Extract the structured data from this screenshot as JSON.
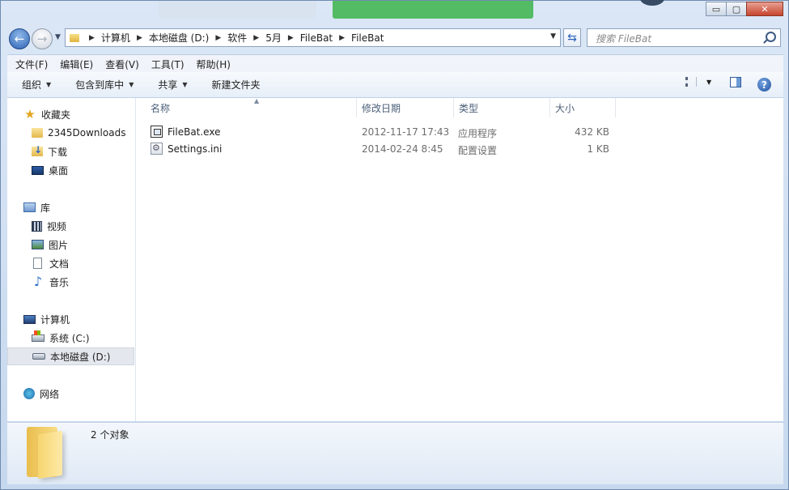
{
  "window": {
    "controls": {
      "minimize": "▭",
      "maximize": "▢",
      "close": "✕"
    }
  },
  "nav": {
    "breadcrumbs": [
      "计算机",
      "本地磁盘 (D:)",
      "软件",
      "5月",
      "FileBat",
      "FileBat"
    ],
    "search_placeholder": "搜索 FileBat"
  },
  "menubar": [
    "文件(F)",
    "编辑(E)",
    "查看(V)",
    "工具(T)",
    "帮助(H)"
  ],
  "commandbar": [
    "组织",
    "包含到库中",
    "共享",
    "新建文件夹"
  ],
  "sidebar": {
    "favorites": {
      "label": "收藏夹",
      "items": [
        "2345Downloads",
        "下载",
        "桌面"
      ]
    },
    "libraries": {
      "label": "库",
      "items": [
        "视频",
        "图片",
        "文档",
        "音乐"
      ]
    },
    "computer": {
      "label": "计算机",
      "items": [
        "系统 (C:)",
        "本地磁盘 (D:)"
      ]
    },
    "network": {
      "label": "网络"
    }
  },
  "columns": [
    "名称",
    "修改日期",
    "类型",
    "大小"
  ],
  "files": [
    {
      "name": "FileBat.exe",
      "modified": "2012-11-17 17:43",
      "type": "应用程序",
      "size": "432 KB",
      "icon": "exe-icon"
    },
    {
      "name": "Settings.ini",
      "modified": "2014-02-24 8:45",
      "type": "配置设置",
      "size": "1 KB",
      "icon": "ini-icon"
    }
  ],
  "details": {
    "count_text": "2 个对象"
  }
}
